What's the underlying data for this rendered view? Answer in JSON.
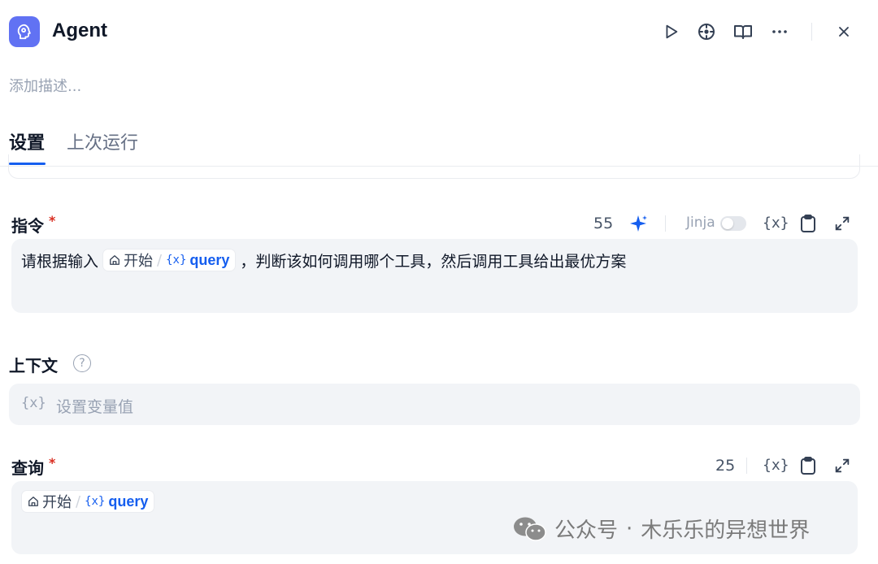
{
  "header": {
    "title": "Agent",
    "icons": [
      "agent-icon",
      "play-icon",
      "locate-icon",
      "book-icon",
      "more-icon",
      "close-icon"
    ]
  },
  "description_placeholder": "添加描述...",
  "tabs": [
    {
      "label": "设置",
      "active": true
    },
    {
      "label": "上次运行",
      "active": false
    }
  ],
  "instruction": {
    "label": "指令",
    "required_mark": "*",
    "count": "55",
    "jinja_label": "Jinja",
    "jinja_enabled": false,
    "text_before": "请根据输入",
    "var_node": "开始",
    "var_name": "query",
    "text_after": "，判断该如何调用哪个工具，然后调用工具给出最优方案"
  },
  "context": {
    "label": "上下文",
    "placeholder": "设置变量值"
  },
  "query": {
    "label": "查询",
    "required_mark": "*",
    "count": "25",
    "var_node": "开始",
    "var_name": "query"
  },
  "symbols": {
    "var_icon": "{x}",
    "slash": "/",
    "help": "?",
    "dot": "·"
  },
  "watermark": {
    "channel": "公众号",
    "name": "木乐乐的异想世界"
  },
  "colors": {
    "accent": "#155eef",
    "app_icon_bg": "#6172f3",
    "field_bg": "#f2f4f7",
    "required": "#d92d20"
  }
}
